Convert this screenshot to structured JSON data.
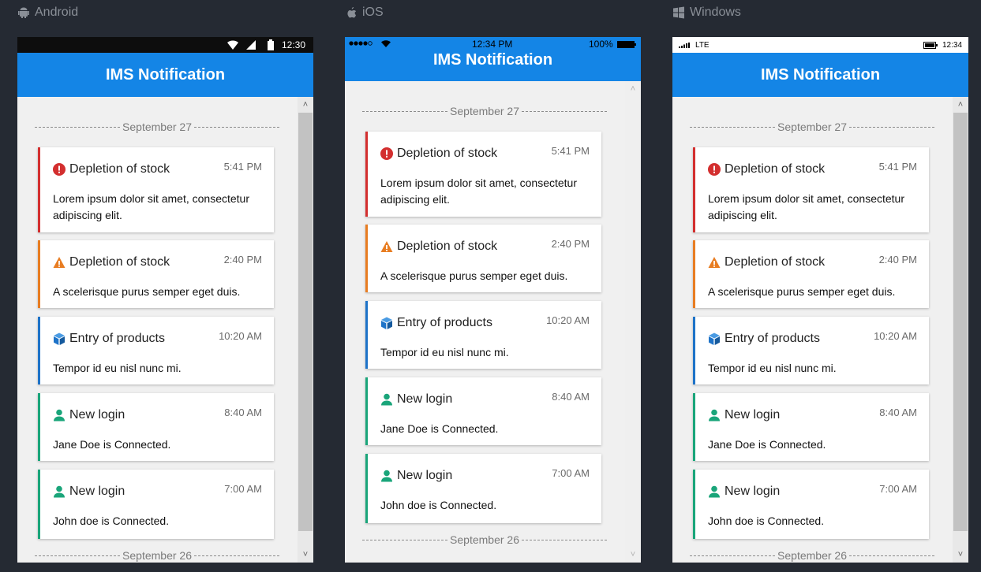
{
  "platforms": {
    "android": {
      "label": "Android",
      "status_time": "12:30",
      "app_title": "IMS Notification"
    },
    "ios": {
      "label": "iOS",
      "status_time": "12:34 PM",
      "battery": "100%",
      "app_title": "IMS Notification"
    },
    "windows": {
      "label": "Windows",
      "network": "LTE",
      "status_time": "12:34",
      "app_title": "IMS Notification"
    }
  },
  "dates": [
    "September 27",
    "September 26"
  ],
  "notifications": [
    {
      "title": "Depletion of stock",
      "time": "5:41 PM",
      "body": "Lorem ipsum dolor sit amet, consectetur adipiscing elit.",
      "type": "error",
      "icon": "exclamation-circle-icon",
      "color": "#d32f2f"
    },
    {
      "title": "Depletion of stock",
      "time": "2:40 PM",
      "body": "A scelerisque purus semper eget duis.",
      "type": "warning",
      "icon": "warning-triangle-icon",
      "color": "#e87d22"
    },
    {
      "title": "Entry of products",
      "time": "10:20 AM",
      "body": "Tempor id eu nisl nunc mi.",
      "type": "info",
      "icon": "cube-icon",
      "color": "#1e73c8"
    },
    {
      "title": "New login",
      "time": "8:40 AM",
      "body": "Jane Doe is Connected.",
      "type": "success",
      "icon": "user-icon",
      "color": "#1aa57a"
    },
    {
      "title": "New login",
      "time": "7:00 AM",
      "body": "John doe is Connected.",
      "type": "success",
      "icon": "user-icon",
      "color": "#1aa57a"
    }
  ]
}
